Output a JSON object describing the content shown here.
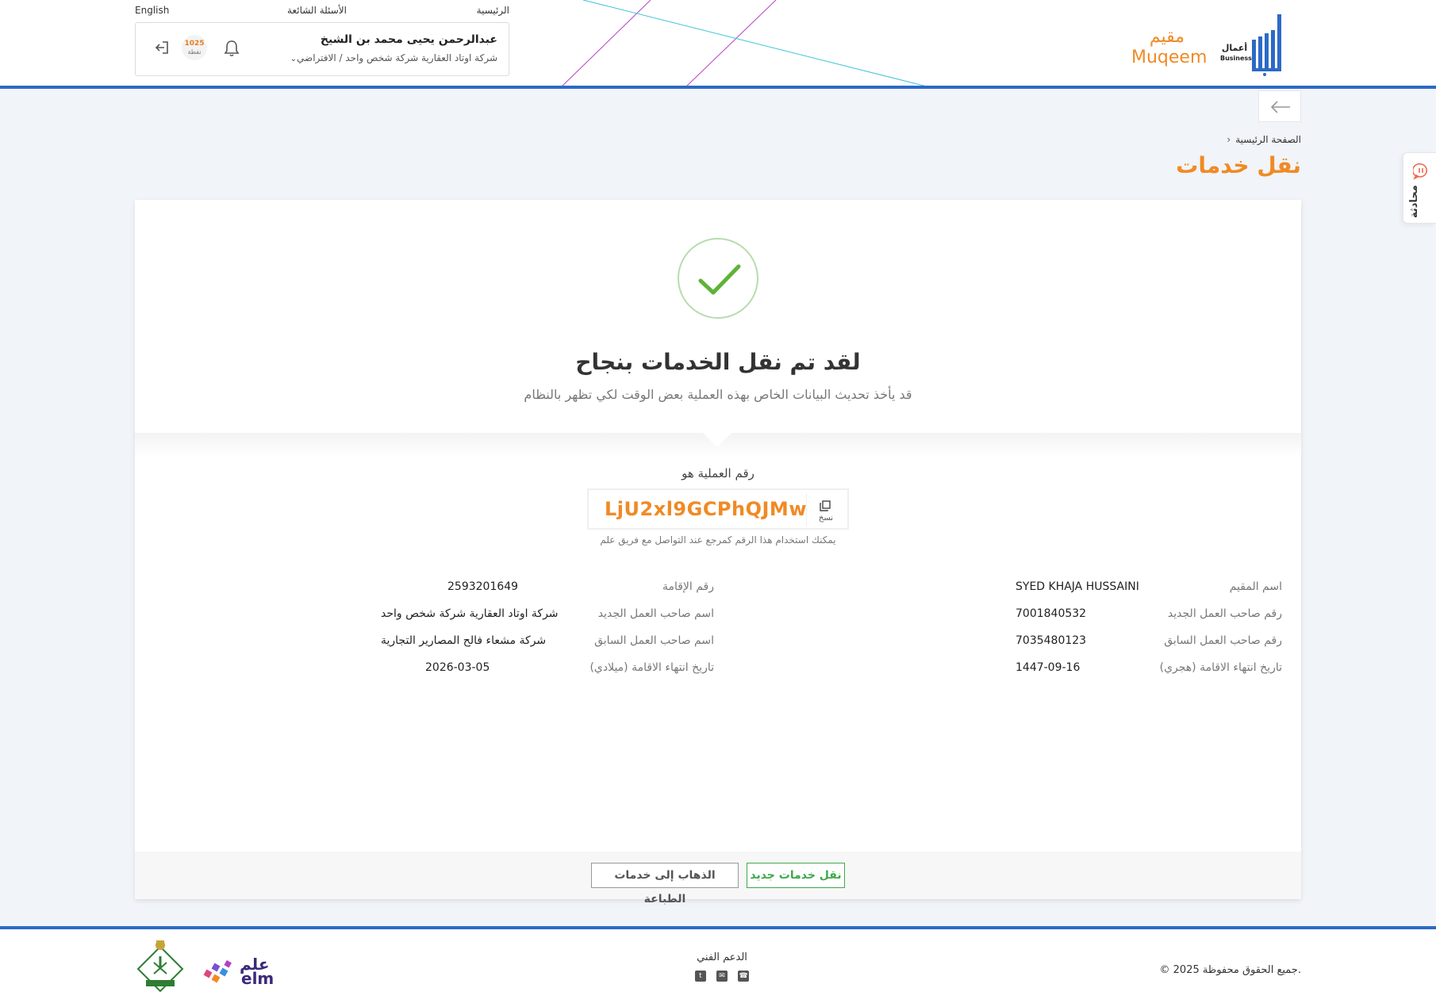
{
  "header": {
    "top_links": {
      "home": "الرئيسية",
      "faq": "الأسئلة الشائعة",
      "language": "English"
    },
    "user": {
      "name": "عبدالرحمن يحيى محمد بن الشيخ",
      "company": "شركة اوتاد العقارية شركة شخص واحد / الافتراضي",
      "points": "1025",
      "points_label": "نقطة"
    },
    "logos": {
      "absher_ar": "أعمال",
      "absher_en": "Business",
      "muqeem_ar": "مقيم",
      "muqeem_en": "Muqeem"
    }
  },
  "breadcrumb": {
    "home": "الصفحة الرئيسية"
  },
  "page_title": "نقل خدمات",
  "chat_tab": {
    "label": "محادثة"
  },
  "result": {
    "title": "لقد تم نقل الخدمات بنجاح",
    "subtitle": "قد يأخذ تحديث البيانات الخاص بهذه العملية بعض الوقت لكي تظهر بالنظام",
    "reference_label": "رقم العملية هو",
    "reference_code": "LjU2xl9GCPhQJMw",
    "copy_label": "نسخ",
    "reference_note": "يمكنك استخدام هذا الرقم كمرجع عند التواصل مع فريق علم"
  },
  "details": {
    "resident_name_label": "اسم المقيم",
    "resident_name": "SYED KHAJA HUSSAINI",
    "iqama_number_label": "رقم الإقامة",
    "iqama_number": "2593201649",
    "new_employer_number_label": "رقم صاحب العمل الجديد",
    "new_employer_number": "7001840532",
    "new_employer_name_label": "اسم صاحب العمل الجديد",
    "new_employer_name": "شركة اوتاد العقارية شركة شخص واحد",
    "old_employer_number_label": "رقم صاحب العمل السابق",
    "old_employer_number": "7035480123",
    "old_employer_name_label": "اسم صاحب العمل السابق",
    "old_employer_name": "شركة مشعاء فالح المصارير التجارية",
    "expiry_hijri_label": "تاريخ انتهاء الاقامة (هجري)",
    "expiry_hijri": "1447-09-16",
    "expiry_gregorian_label": "تاريخ انتهاء الاقامة (ميلادي)",
    "expiry_gregorian": "2026-03-05"
  },
  "actions": {
    "new_transfer": "نقل خدمات جديد",
    "print_services": "الذهاب إلى خدمات الطباعة"
  },
  "footer": {
    "copyright": "© جميع الحقوق محفوظة 2025.",
    "support_label": "الدعم الفني",
    "elm_ar": "علم",
    "elm_en": "elm",
    "support_icons": [
      "phone-icon",
      "mail-icon",
      "twitter-icon"
    ]
  },
  "colors": {
    "accent_orange": "#f08a24",
    "header_blue": "#2c6ac6",
    "success_green": "#3fa84a",
    "background": "#f1f4f8"
  }
}
